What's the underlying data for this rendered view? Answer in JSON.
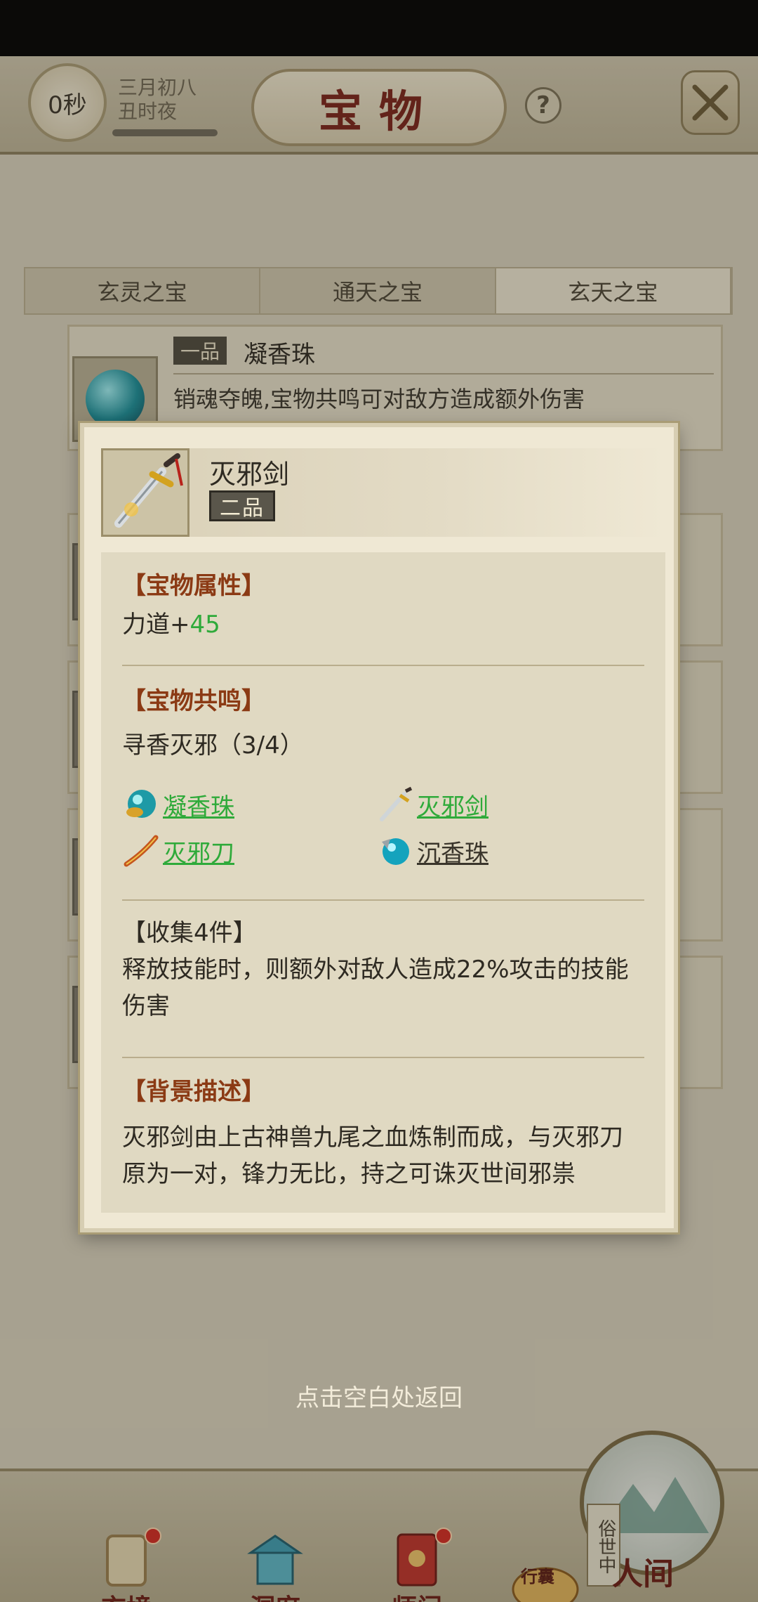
{
  "status": {
    "timer": "0秒",
    "date_line1": "三月初八",
    "date_line2": "丑时夜"
  },
  "header": {
    "title": "宝物",
    "help": "?"
  },
  "tabs": [
    {
      "label": "玄灵之宝"
    },
    {
      "label": "通天之宝"
    },
    {
      "label": "玄天之宝"
    }
  ],
  "list": {
    "first_item": {
      "grade": "一品",
      "name": "凝香珠",
      "desc": "销魂夺魄,宝物共鸣可对敌方造成额外伤害"
    }
  },
  "popup": {
    "name": "灭邪剑",
    "grade": "二品",
    "attr_title": "【宝物属性】",
    "attr_label": "力道+",
    "attr_value": "45",
    "resonance_title": "【宝物共鸣】",
    "resonance_set": "寻香灭邪（3/4）",
    "resonance_items": [
      {
        "name": "凝香珠",
        "icon": "orb-icon",
        "owned": true
      },
      {
        "name": "灭邪剑",
        "icon": "sword-icon",
        "owned": true
      },
      {
        "name": "灭邪刀",
        "icon": "blade-icon",
        "owned": true
      },
      {
        "name": "沉香珠",
        "icon": "orb-icon",
        "owned": false
      }
    ],
    "collect_title": "【收集4件】",
    "collect_desc": "释放技能时，则额外对敌人造成22%攻击的技能伤害",
    "background_title": "【背景描述】",
    "background_desc": "灭邪剑由上古神兽九尾之血炼制而成，与灭邪刀原为一对，锋力无比，持之可诛灭世间邪祟"
  },
  "return_hint": "点击空白处返回",
  "nav": [
    {
      "label": "玄境"
    },
    {
      "label": "洞府"
    },
    {
      "label": "师门"
    }
  ],
  "nav_bag": "行囊",
  "nav_world": {
    "badge": "俗世中",
    "label": "人间"
  },
  "colors": {
    "accent_red": "#7a231a",
    "section_title": "#8b3a14",
    "owned_green": "#2faa3a"
  }
}
